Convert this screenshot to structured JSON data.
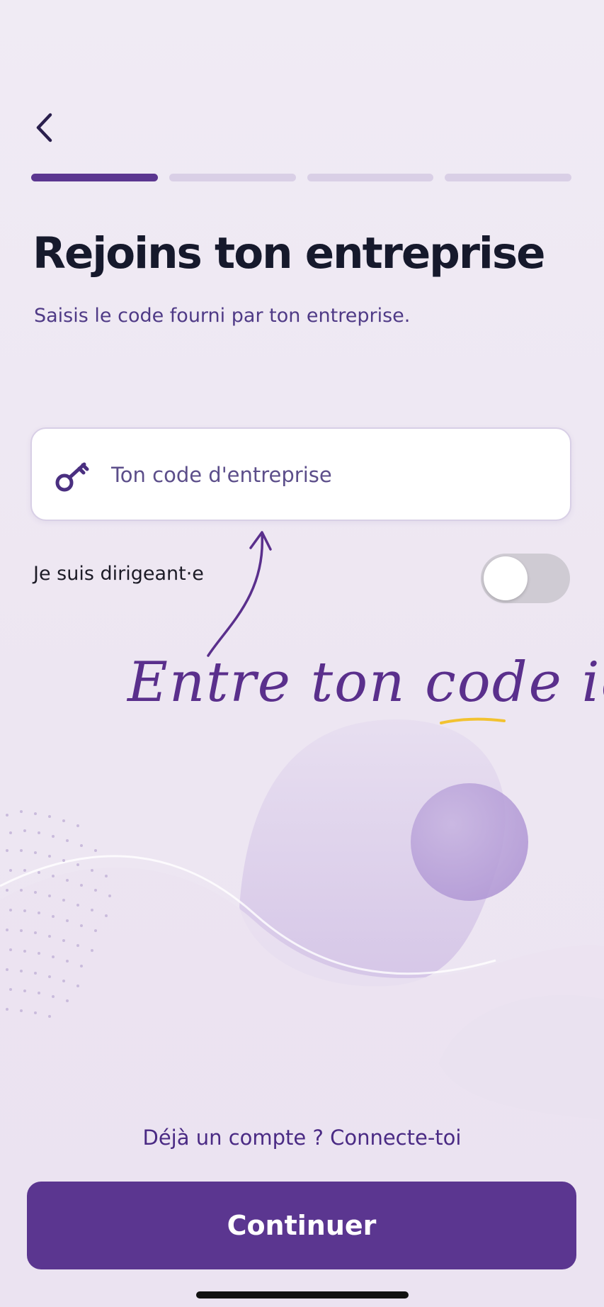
{
  "header": {
    "back_icon": "chevron-left-icon"
  },
  "progress": {
    "total_steps": 4,
    "current_step": 1
  },
  "main": {
    "title": "Rejoins ton entreprise",
    "subtitle": "Saisis le code fourni par ton entreprise."
  },
  "code_field": {
    "icon": "key-icon",
    "placeholder": "Ton code d'entreprise",
    "value": ""
  },
  "manager_toggle": {
    "label": "Je suis dirigeant·e",
    "checked": false
  },
  "hint": {
    "text": "Entre ton code ici"
  },
  "footer": {
    "login_prompt": "Déjà un compte ? ",
    "login_link": "Connecte-toi",
    "continue_label": "Continuer"
  },
  "colors": {
    "accent": "#5b3690",
    "title": "#16192c",
    "subtitle": "#4f3a86",
    "background": "#efe9f3",
    "progress_inactive": "#d9cfe6",
    "hint_underline": "#f2c230"
  }
}
